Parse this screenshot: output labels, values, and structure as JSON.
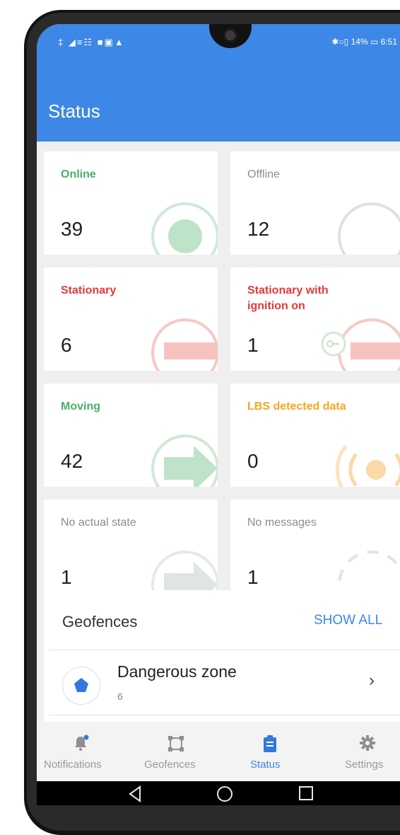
{
  "status_bar": {
    "left_icons": "‡ ◢≡☷ ■▣▲",
    "right_text": "✱○▯ 14% ▭ 6:51"
  },
  "app_bar": {
    "title": "Status"
  },
  "colors": {
    "primary": "#3d87e6",
    "online": "#4caf6a",
    "offline": "#9e9e9e",
    "stationary": "#e53935",
    "moving": "#4caf6a",
    "lbs": "#f5a623",
    "no_state": "#9e9e9e"
  },
  "status_cards": [
    {
      "label": "Online",
      "count": "39",
      "color": "#4caf6a",
      "icon": "online-dot-icon"
    },
    {
      "label": "Offline",
      "count": "12",
      "color": "#9e9e9e",
      "icon": "offline-ring-icon"
    },
    {
      "label": "Stationary",
      "count": "6",
      "color": "#e53935",
      "icon": "stationary-bar-icon"
    },
    {
      "label": "Stationary with ignition on",
      "count": "1",
      "color": "#e53935",
      "icon": "ignition-key-icon"
    },
    {
      "label": "Moving",
      "count": "42",
      "color": "#4caf6a",
      "icon": "moving-arrow-icon"
    },
    {
      "label": "LBS detected data",
      "count": "0",
      "color": "#f5a623",
      "icon": "lbs-signal-icon"
    },
    {
      "label": "No actual state",
      "count": "1",
      "color": "#9e9e9e",
      "icon": "gray-arrow-icon"
    },
    {
      "label": "No messages",
      "count": "1",
      "color": "#9e9e9e",
      "icon": "dashed-ring-icon"
    }
  ],
  "geofences": {
    "title": "Geofences",
    "show_all": "SHOW ALL",
    "items": [
      {
        "name": "Dangerous zone",
        "count": "6",
        "icon": "pentagon-icon"
      }
    ]
  },
  "bottom_nav": {
    "items": [
      {
        "label": "Notifications",
        "icon": "bell-icon",
        "active": false
      },
      {
        "label": "Geofences",
        "icon": "geofence-square-icon",
        "active": false
      },
      {
        "label": "Status",
        "icon": "clipboard-icon",
        "active": true
      },
      {
        "label": "Settings",
        "icon": "gear-icon",
        "active": false
      }
    ]
  },
  "system_nav": {
    "back": "◁",
    "home": "○",
    "recents": "□"
  }
}
